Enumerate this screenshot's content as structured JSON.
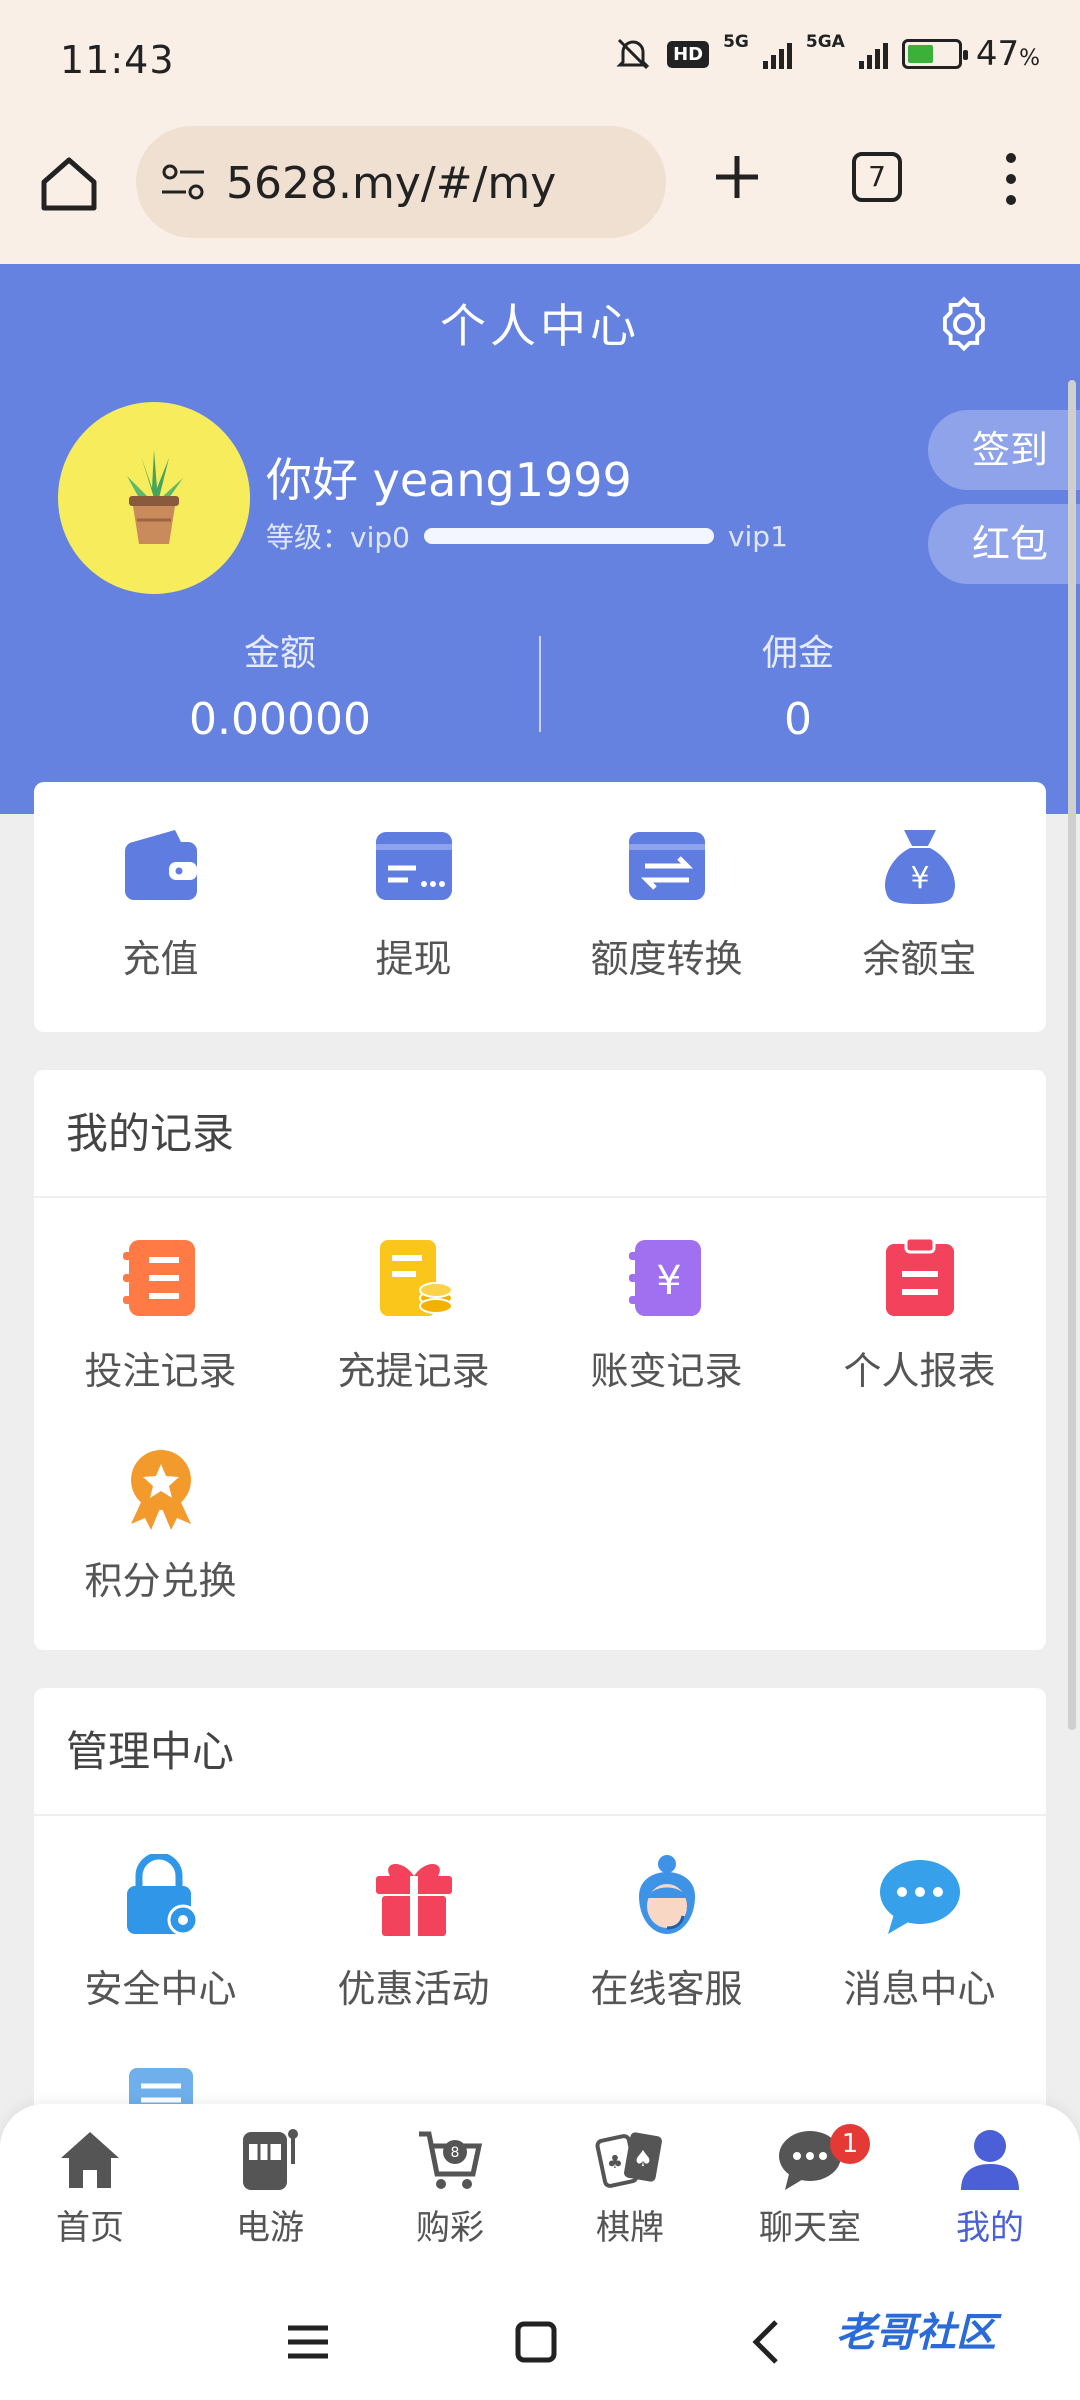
{
  "status": {
    "time": "11:43",
    "network1": "5G",
    "network2": "5GA",
    "hd": "HD",
    "battery": "47",
    "battery_unit": "%"
  },
  "browser": {
    "url": "5628.my/#/my",
    "tab_count": "7"
  },
  "header": {
    "title": "个人中心",
    "greeting": "你好 yeang1999",
    "level_label": "等级：vip0",
    "level_next": "vip1",
    "level_progress": 0,
    "sign_in": "签到",
    "red_packet": "红包",
    "balance_label": "金额",
    "balance_value": "0.00000",
    "commission_label": "佣金",
    "commission_value": "0"
  },
  "quick_actions": [
    {
      "label": "充值",
      "icon": "wallet-icon"
    },
    {
      "label": "提现",
      "icon": "card-icon"
    },
    {
      "label": "额度转换",
      "icon": "transfer-icon"
    },
    {
      "label": "余额宝",
      "icon": "money-bag-icon"
    }
  ],
  "records": {
    "title": "我的记录",
    "items": [
      {
        "label": "投注记录",
        "icon": "bet-record-icon",
        "color": "#ff7a45"
      },
      {
        "label": "充提记录",
        "icon": "deposit-record-icon",
        "color": "#fac61c"
      },
      {
        "label": "账变记录",
        "icon": "account-change-icon",
        "color": "#a070f0"
      },
      {
        "label": "个人报表",
        "icon": "report-icon",
        "color": "#f2425c"
      },
      {
        "label": "积分兑换",
        "icon": "points-medal-icon",
        "color": "#f39a2c"
      }
    ]
  },
  "management": {
    "title": "管理中心",
    "items": [
      {
        "label": "安全中心",
        "icon": "lock-gear-icon",
        "color": "#2f96e8"
      },
      {
        "label": "优惠活动",
        "icon": "gift-icon",
        "color": "#f2425c"
      },
      {
        "label": "在线客服",
        "icon": "support-agent-icon",
        "color": "#3e93e6"
      },
      {
        "label": "消息中心",
        "icon": "chat-bubble-icon",
        "color": "#36a0ea"
      }
    ]
  },
  "bottom_nav": {
    "items": [
      {
        "label": "首页",
        "icon": "home-icon"
      },
      {
        "label": "电游",
        "icon": "slot-machine-icon"
      },
      {
        "label": "购彩",
        "icon": "lottery-cart-icon"
      },
      {
        "label": "棋牌",
        "icon": "cards-icon"
      },
      {
        "label": "聊天室",
        "icon": "chat-room-icon",
        "badge": "1"
      },
      {
        "label": "我的",
        "icon": "profile-icon",
        "active": true
      }
    ]
  },
  "watermark": "老哥社区"
}
